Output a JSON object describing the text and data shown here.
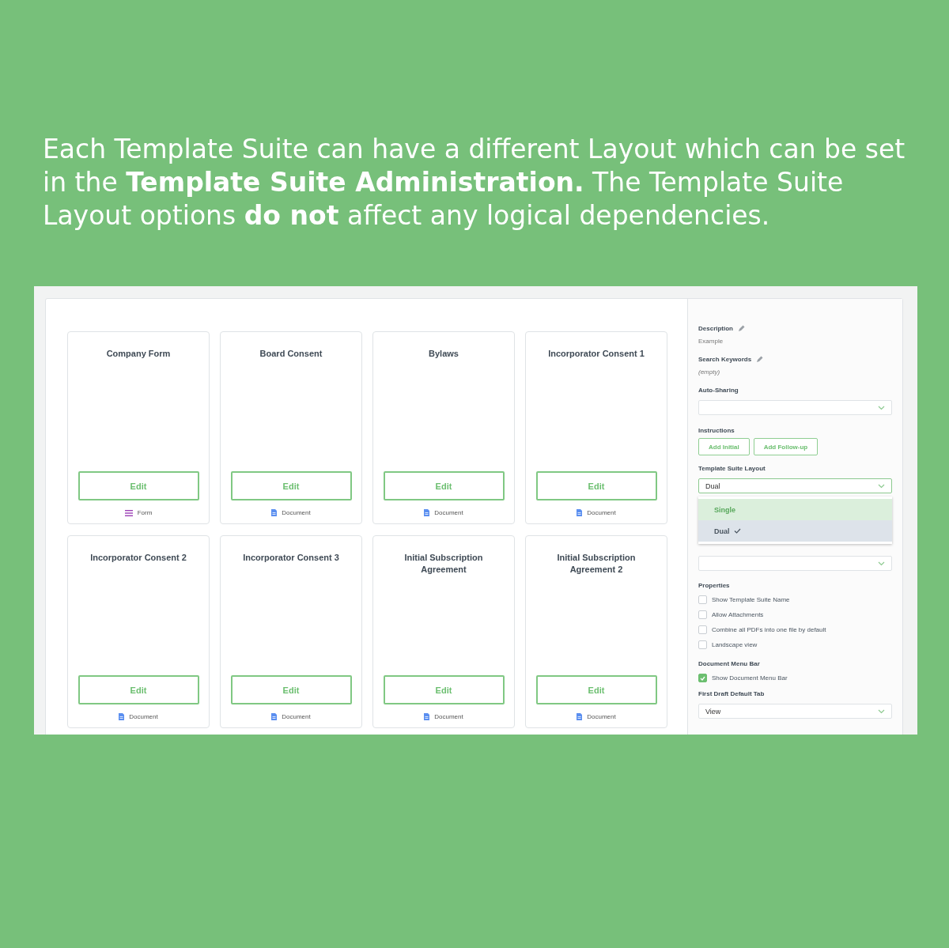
{
  "headline": "Each Template Suite can have a different Layout which can be set in the **Template Suite Administration.** The Template Suite Layout options **do not** affect any logical dependencies.",
  "templates": [
    {
      "title": "Company Form",
      "button": "Edit",
      "kind": "form",
      "type_label": "Form"
    },
    {
      "title": "Board Consent",
      "button": "Edit",
      "kind": "document",
      "type_label": "Document"
    },
    {
      "title": "Bylaws",
      "button": "Edit",
      "kind": "document",
      "type_label": "Document"
    },
    {
      "title": "Incorporator Consent 1",
      "button": "Edit",
      "kind": "document",
      "type_label": "Document"
    },
    {
      "title": "Incorporator Consent 2",
      "button": "Edit",
      "kind": "document",
      "type_label": "Document"
    },
    {
      "title": "Incorporator Consent 3",
      "button": "Edit",
      "kind": "document",
      "type_label": "Document"
    },
    {
      "title": "Initial Subscription Agreement",
      "button": "Edit",
      "kind": "document",
      "type_label": "Document"
    },
    {
      "title": "Initial Subscription Agreement 2",
      "button": "Edit",
      "kind": "document",
      "type_label": "Document"
    }
  ],
  "settings": {
    "description": {
      "label": "Description",
      "value": "Example"
    },
    "search_keywords": {
      "label": "Search Keywords",
      "value": "(empty)"
    },
    "auto_sharing": {
      "label": "Auto-Sharing"
    },
    "instructions": {
      "label": "Instructions",
      "buttons": [
        "Add Initial",
        "Add Follow-up"
      ]
    },
    "layout": {
      "label": "Template Suite Layout",
      "value": "Dual",
      "options": [
        {
          "label": "Single",
          "highlighted": true,
          "selected": false
        },
        {
          "label": "Dual",
          "highlighted": false,
          "selected": true
        }
      ]
    },
    "properties": {
      "label": "Properties",
      "items": [
        {
          "label": "Show Template Suite Name",
          "checked": false
        },
        {
          "label": "Allow Attachments",
          "checked": false
        },
        {
          "label": "Combine all PDFs into one file by default",
          "checked": false
        },
        {
          "label": "Landscape view",
          "checked": false
        }
      ]
    },
    "menu_bar": {
      "label": "Document Menu Bar",
      "items": [
        {
          "label": "Show Document Menu Bar",
          "checked": true
        }
      ]
    },
    "default_tab": {
      "label": "First Draft Default Tab",
      "value": "View"
    }
  }
}
